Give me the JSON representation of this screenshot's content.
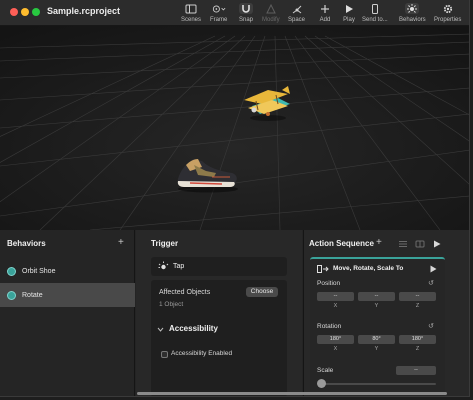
{
  "window": {
    "title": "Sample.rcproject"
  },
  "toolbar": {
    "items": [
      {
        "label": "Scenes",
        "icon": "scenes-icon"
      },
      {
        "label": "Frame",
        "icon": "frame-icon"
      },
      {
        "label": "Snap",
        "icon": "magnet-icon"
      },
      {
        "label": "Modify",
        "icon": "modify-icon"
      },
      {
        "label": "Space",
        "icon": "space-icon"
      },
      {
        "label": "Add",
        "icon": "plus-icon"
      },
      {
        "label": "Play",
        "icon": "play-icon"
      },
      {
        "label": "Send to...",
        "icon": "send-to-device-icon"
      },
      {
        "label": "Behaviors",
        "icon": "behaviors-icon"
      },
      {
        "label": "Properties",
        "icon": "gear-icon"
      }
    ]
  },
  "behaviors": {
    "title": "Behaviors",
    "add": "+",
    "items": [
      {
        "label": "Orbit Shoe"
      },
      {
        "label": "Rotate"
      }
    ],
    "dot_color": "#3aa39a"
  },
  "trigger": {
    "title": "Trigger",
    "type": "Tap",
    "affected_objects_label": "Affected Objects",
    "choose_label": "Choose",
    "object_count": "1 Object",
    "accessibility_title": "Accessibility",
    "accessibility_enabled_label": "Accessibility Enabled"
  },
  "action": {
    "title": "Action Sequence",
    "add": "+",
    "step_title": "Move, Rotate, Scale To",
    "accent_color": "#3aa39a",
    "position_label": "Position",
    "position_values": [
      "--",
      "--",
      "--"
    ],
    "rotation_label": "Rotation",
    "rotation_values": [
      "180°",
      "80°",
      "180°"
    ],
    "axes": [
      "X",
      "Y",
      "Z"
    ],
    "scale_label": "Scale",
    "scale_value": "--"
  }
}
